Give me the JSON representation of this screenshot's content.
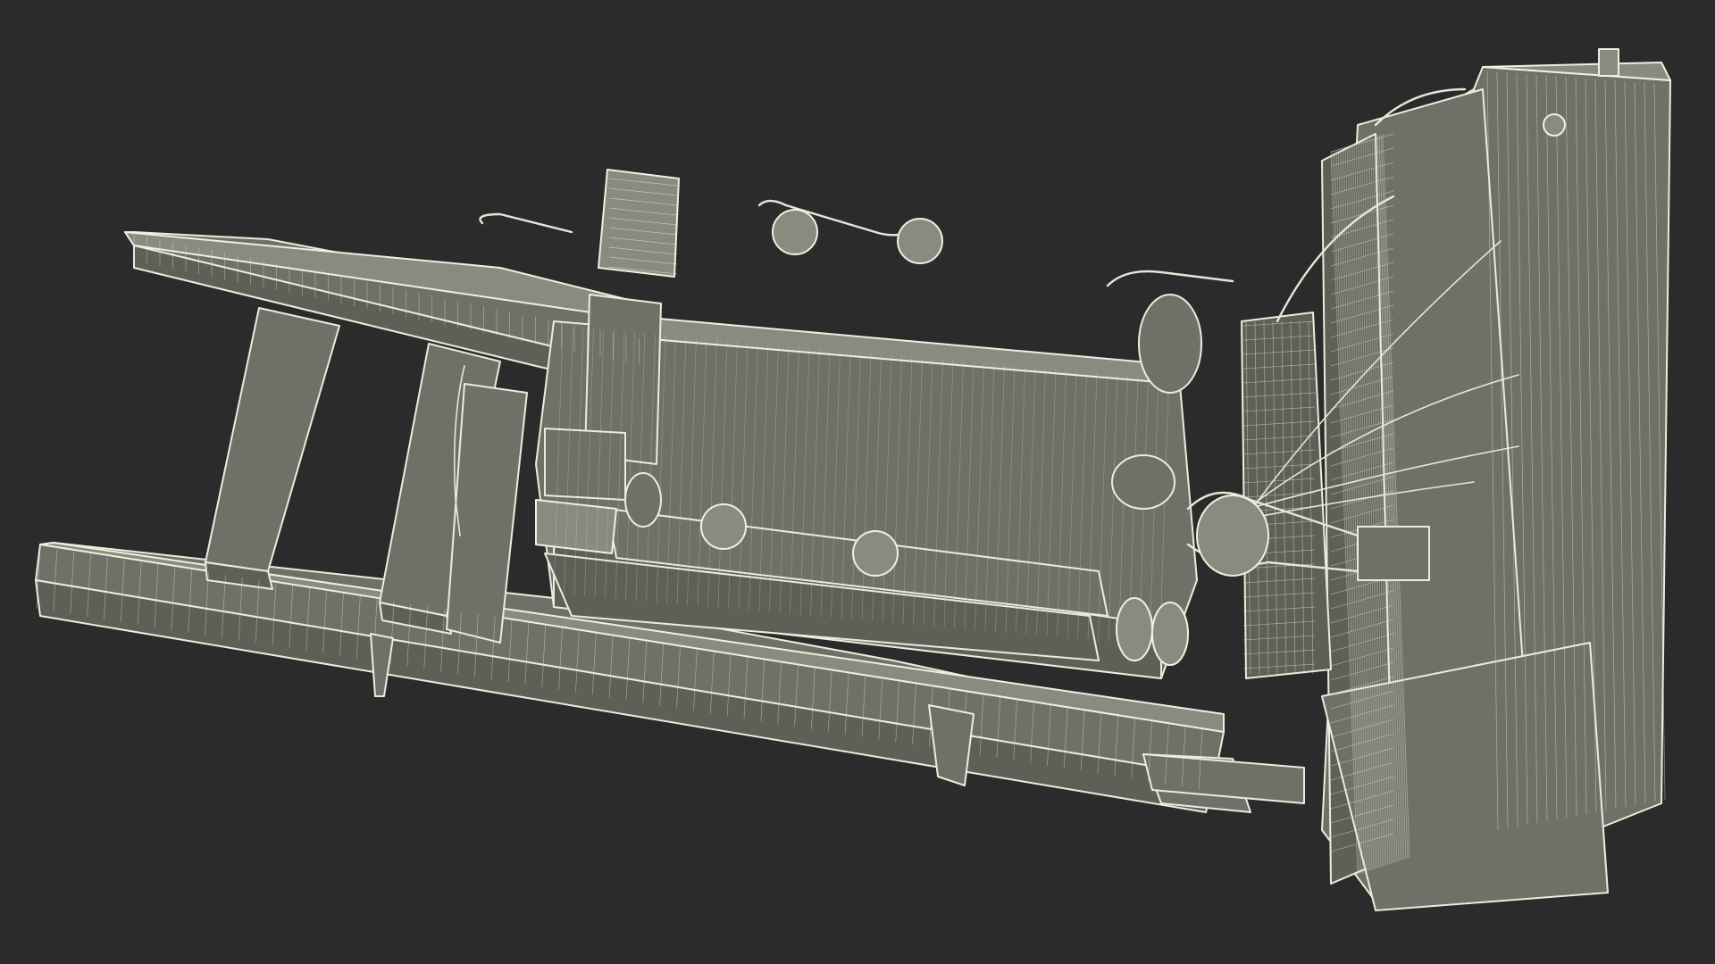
{
  "scene": {
    "subject": "diesel-generator-wireframe",
    "colors": {
      "background": "#2b2b2b",
      "wire": "#e6e6d6",
      "surface": "#707068",
      "surface_dark": "#5f5f58",
      "surface_light": "#8a8a80"
    },
    "icons": [
      "generator-icon"
    ]
  }
}
